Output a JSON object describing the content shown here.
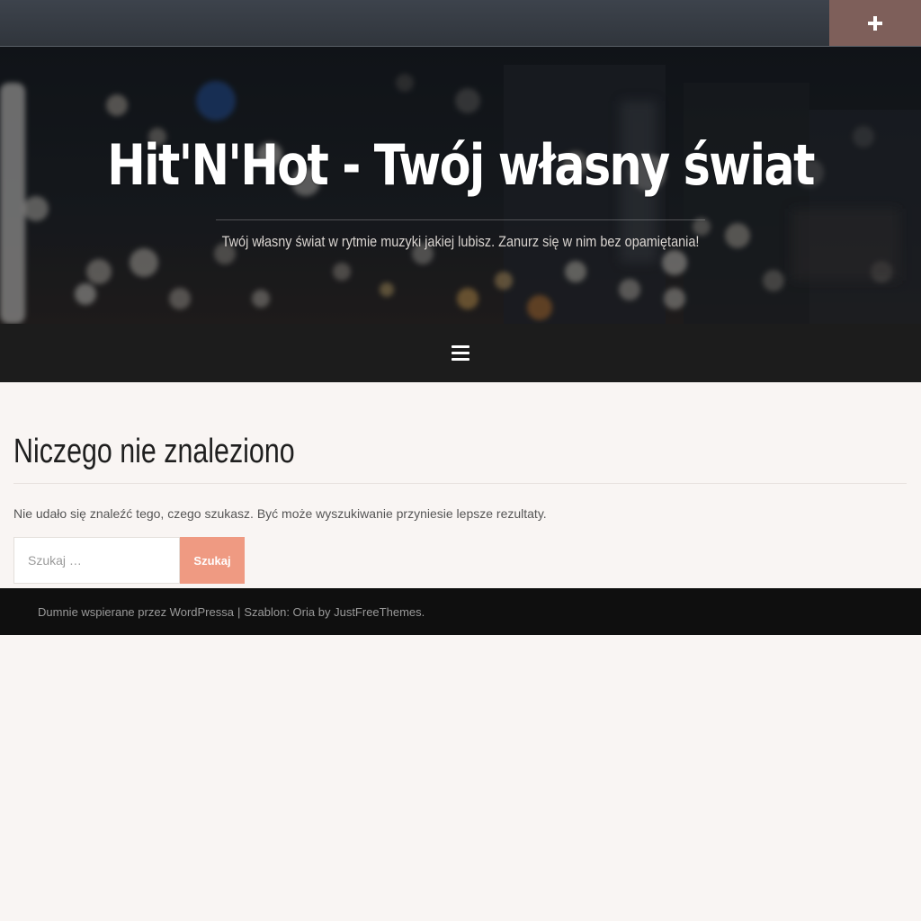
{
  "header": {
    "site_title": "Hit'N'Hot - Twój własny świat",
    "tagline": "Twój własny świat w rytmie muzyki jakiej lubisz. Zanurz się w nim bez opamiętania!",
    "topbar_toggle_icon": "plus-icon",
    "menu_icon": "hamburger-menu-icon"
  },
  "main": {
    "page_title": "Niczego nie znaleziono",
    "message": "Nie udało się znaleźć tego, czego szukasz. Być może wyszukiwanie przyniesie lepsze rezultaty.",
    "search": {
      "placeholder": "Szukaj …",
      "button_label": "Szukaj"
    }
  },
  "footer": {
    "powered_text": "Dumnie wspierane przez WordPressa",
    "separator": "|",
    "theme_prefix": "Szablon: Oria by",
    "theme_link": "JustFreeThemes",
    "suffix": "."
  },
  "colors": {
    "topbar": "#353a42",
    "topbar_toggle": "#7e5f5a",
    "navbar": "#1c1c1c",
    "page_background": "#f9f5f3",
    "search_button": "#ef9a82",
    "footer": "#0f0f0f"
  }
}
